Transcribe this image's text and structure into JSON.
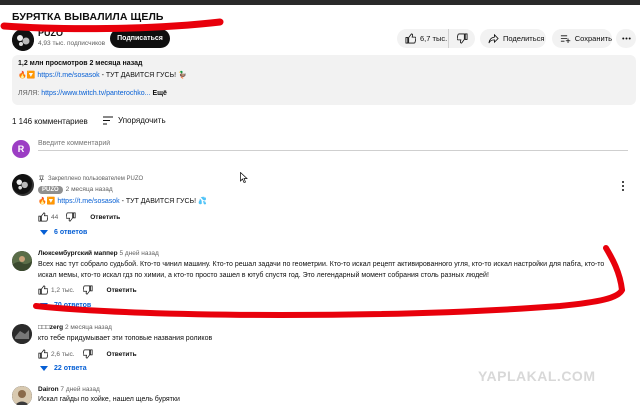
{
  "video": {
    "title": "БУРЯТКА ВЫВАЛИЛА ЩЕЛЬ",
    "channel_name": "PUZO",
    "subscribers": "4,93 тыс. подписчиков",
    "subscribe_label": "Подписаться",
    "likes": "6,7 тыс.",
    "share_label": "Поделиться",
    "save_label": "Сохранить"
  },
  "description": {
    "stats": "1,2 млн просмотров  2 месяца назад",
    "emoji_prefix": "🔥🔽",
    "link1": "https://t.me/sosasok",
    "line2_rest": " - ТУТ ДАВИТСЯ ГУСЬ! 🦆",
    "line3_prefix": "ЛЯЛЯ: ",
    "link2": "https://www.twitch.tv/panterochko...",
    "more_label": "Ещё"
  },
  "comments_header": {
    "count": "1 146 комментариев",
    "sort_label": "Упорядочить",
    "avatar_letter": "R",
    "add_placeholder": "Введите комментарий"
  },
  "comments": [
    {
      "pinned_label": "Закреплено пользователем PUZO",
      "author": "PUZO",
      "time": "2 месяца назад",
      "text_prefix": "🔥🔽 ",
      "link": "https://t.me/sosasok",
      "text_rest": " - ТУТ ДАВИТСЯ ГУСЬ! 💦",
      "likes": "44",
      "reply_label": "Ответить",
      "replies": "6 ответов"
    },
    {
      "author": "Люксембургский маппер",
      "time": "5 дней назад",
      "text_line1": "Всех нас тут собрало судьбой. Кто-то чинил машину. Кто-то решал задачи по геометрии. Кто-то искал рецепт активированного угля, кто-то искал настройки для пабга, кто-то",
      "text_line2": "искал мемы, кто-то искал гдз по химии, а кто-то просто зашел в ютуб спустя год. Это легендарный момент собрания столь разных людей!",
      "likes": "1,2 тыс.",
      "reply_label": "Ответить",
      "replies": "70 ответов"
    },
    {
      "author": "□□□zerg",
      "time": "2 месяца назад",
      "text": "кто тебе придумывает эти топовые названия роликов",
      "likes": "2,6 тыс.",
      "reply_label": "Ответить",
      "replies": "22 ответа"
    },
    {
      "author": "Dairon",
      "time": "7 дней назад",
      "text": "Искал гайды по хойке, нашел щель бурятки"
    }
  ],
  "watermark": "YAPLAKAL.COM",
  "colors": {
    "link": "#065fd4",
    "pill_bg": "#f2f2f2",
    "subscribe_bg": "#0f0f0f",
    "annotation_red": "#e8000b",
    "user_avatar": "#9c3dc4"
  },
  "icons": [
    "thumb-up-icon",
    "thumb-down-icon",
    "share-icon",
    "save-icon",
    "more-icon",
    "sort-icon",
    "pin-icon",
    "chevron-down-icon",
    "kebab-icon",
    "cursor-icon"
  ]
}
